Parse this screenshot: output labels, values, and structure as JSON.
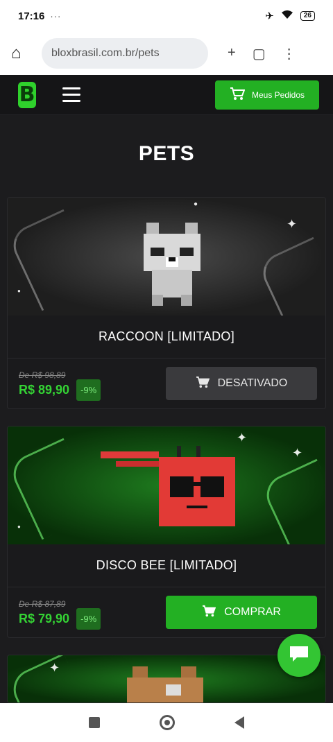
{
  "status_bar": {
    "time": "17:16",
    "left_icons": "··· ",
    "battery": "26"
  },
  "browser": {
    "url": "bloxbrasil.com.br/pets"
  },
  "header": {
    "orders_label": "Meus Pedidos",
    "logo_letter": "B"
  },
  "page": {
    "title": "PETS"
  },
  "products": [
    {
      "name": "RACCOON [LIMITADO]",
      "old_price": "De R$ 98,89",
      "price": "R$ 89,90",
      "discount": "-9%",
      "button_label": "DESATIVADO",
      "button_state": "disabled"
    },
    {
      "name": "DISCO BEE [LIMITADO]",
      "old_price": "De R$ 87,89",
      "price": "R$ 79,90",
      "discount": "-9%",
      "button_label": "COMPRAR",
      "button_state": "enabled"
    }
  ],
  "colors": {
    "accent": "#23b023",
    "price": "#34d334",
    "background": "#1c1c1e"
  },
  "icons": [
    "home-icon",
    "cart-icon",
    "menu-icon",
    "chat-icon",
    "wifi-icon",
    "airplane-icon"
  ]
}
